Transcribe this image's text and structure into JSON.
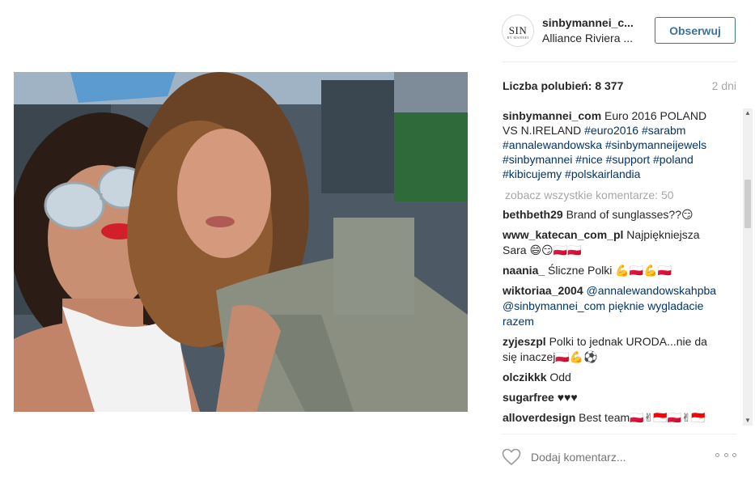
{
  "post": {
    "username": "sinbymannei_c...",
    "location": "Alliance Riviera ...",
    "avatar_text": "SIN",
    "avatar_subtext": "BY MANNEI",
    "follow_label": "Obserwuj",
    "likes_label": "Liczba polubień: 8 377",
    "age_label": "2 dni",
    "photo_description": ""
  },
  "caption": {
    "author": "sinbymannei_com",
    "text": "Euro 2016 POLAND VS N.IRELAND",
    "tags": [
      "#euro2016",
      "#sarabm",
      "#annalewandowska",
      "#sinbymanneijewels",
      "#sinbymannei",
      "#nice",
      "#support",
      "#poland",
      "#kibicujemy",
      "#polskairlandia"
    ]
  },
  "view_all_label": "zobacz wszystkie komentarze: 50",
  "comments": [
    {
      "author": "bethbeth29",
      "text": "Brand of sunglasses??😏"
    },
    {
      "author": "www_katecan_com_pl",
      "text": "Najpiękniejsza Sara 😄😏🇵🇱🇵🇱"
    },
    {
      "author": "naania_",
      "text": "Śliczne Polki 💪🇵🇱💪🇵🇱"
    },
    {
      "author": "wiktoriaa_2004",
      "text": "@annalewandowskahpba @sinbymannei_com pięknie wygladacie razem"
    },
    {
      "author": "zyjeszpl",
      "text": "Polki to jednak URODA...nie da się inaczej🇵🇱💪⚽"
    },
    {
      "author": "olczikkk",
      "text": "Odd"
    },
    {
      "author": "sugarfree",
      "text": "♥♥♥"
    },
    {
      "author": "alloverdesign",
      "text": "Best team🇵🇱✌🇮🇩🇵🇱✌🇮🇩"
    }
  ],
  "footer": {
    "comment_placeholder": "Dodaj komentarz...",
    "like_icon": "heart-outline-icon",
    "more_icon": "more-options-icon"
  },
  "colors": {
    "link": "#003569",
    "follow": "#3f729b",
    "muted": "#a5a7aa"
  }
}
